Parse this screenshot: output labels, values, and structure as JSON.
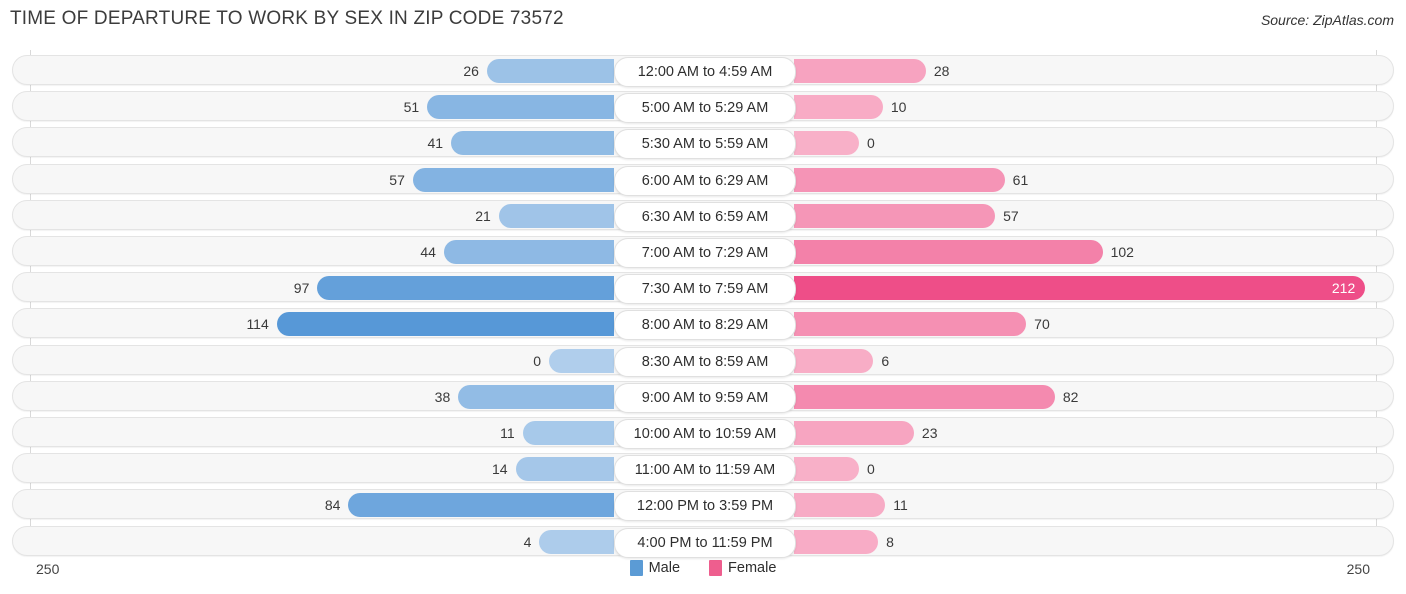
{
  "header": {
    "title": "TIME OF DEPARTURE TO WORK BY SEX IN ZIP CODE 73572",
    "source": "Source: ZipAtlas.com"
  },
  "legend": {
    "male_label": "Male",
    "female_label": "Female",
    "male_color": "#5B9BD5",
    "female_color": "#EE5E8E"
  },
  "axis": {
    "left_max": "250",
    "right_max": "250"
  },
  "chart_data": {
    "type": "bar",
    "orientation": "horizontal-diverging",
    "title": "TIME OF DEPARTURE TO WORK BY SEX IN ZIP CODE 73572",
    "xlabel": "",
    "ylabel": "",
    "xlim": [
      250,
      250
    ],
    "grid": false,
    "legend_position": "bottom-center",
    "categories": [
      "12:00 AM to 4:59 AM",
      "5:00 AM to 5:29 AM",
      "5:30 AM to 5:59 AM",
      "6:00 AM to 6:29 AM",
      "6:30 AM to 6:59 AM",
      "7:00 AM to 7:29 AM",
      "7:30 AM to 7:59 AM",
      "8:00 AM to 8:29 AM",
      "8:30 AM to 8:59 AM",
      "9:00 AM to 9:59 AM",
      "10:00 AM to 10:59 AM",
      "11:00 AM to 11:59 AM",
      "12:00 PM to 3:59 PM",
      "4:00 PM to 11:59 PM"
    ],
    "series": [
      {
        "name": "Male",
        "color": "#5B9BD5",
        "values": [
          26,
          51,
          41,
          57,
          21,
          44,
          97,
          114,
          0,
          38,
          11,
          14,
          84,
          4
        ]
      },
      {
        "name": "Female",
        "color": "#EE5E8E",
        "values": [
          28,
          10,
          0,
          61,
          57,
          102,
          212,
          70,
          6,
          82,
          23,
          0,
          11,
          8
        ]
      }
    ]
  }
}
